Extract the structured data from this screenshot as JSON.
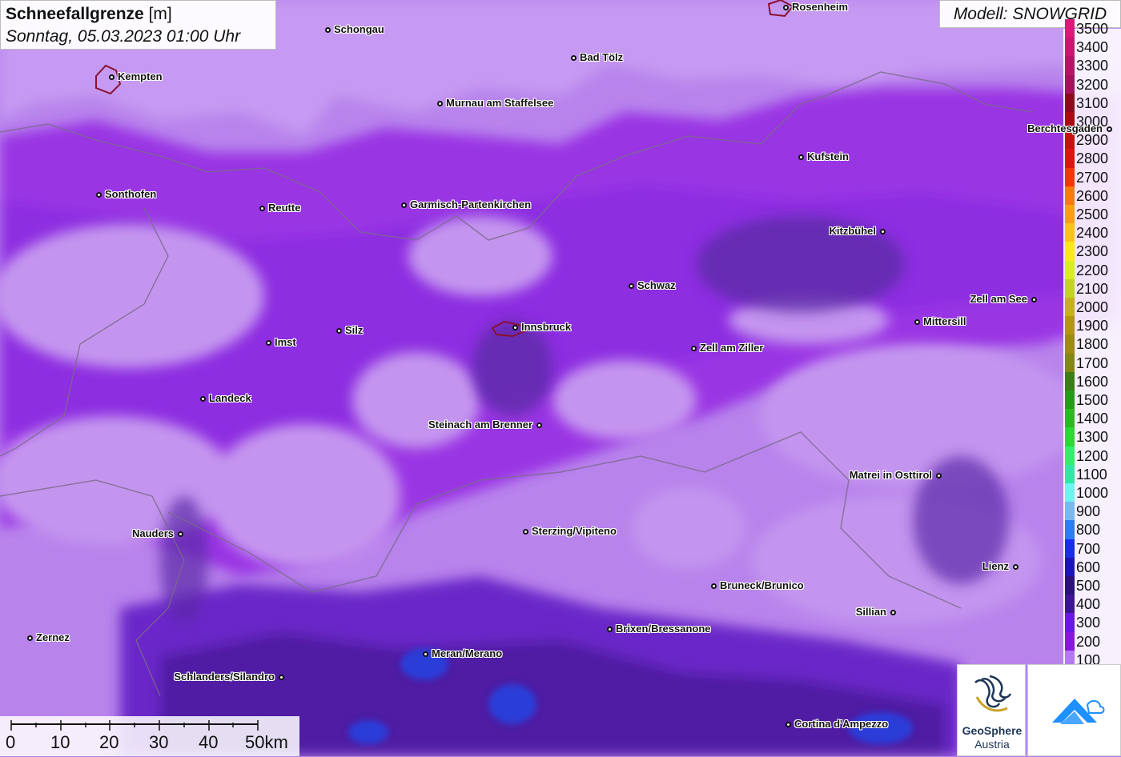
{
  "title": {
    "main": "Schneefallgrenze",
    "unit": "[m]",
    "datetime": "Sonntag, 05.03.2023 01:00 Uhr"
  },
  "model": "Modell: SNOWGRID",
  "legend": [
    {
      "label": "3500",
      "color": "#d81b78"
    },
    {
      "label": "3400",
      "color": "#c7186e"
    },
    {
      "label": "3300",
      "color": "#b51565"
    },
    {
      "label": "3200",
      "color": "#a3135b"
    },
    {
      "label": "3100",
      "color": "#8b0a1c"
    },
    {
      "label": "3000",
      "color": "#a80c12"
    },
    {
      "label": "2900",
      "color": "#c8100e"
    },
    {
      "label": "2800",
      "color": "#e0140d"
    },
    {
      "label": "2700",
      "color": "#f5350a"
    },
    {
      "label": "2600",
      "color": "#f57c10"
    },
    {
      "label": "2500",
      "color": "#f9a010"
    },
    {
      "label": "2400",
      "color": "#fbc412"
    },
    {
      "label": "2300",
      "color": "#fbe914"
    },
    {
      "label": "2200",
      "color": "#d8ef1a"
    },
    {
      "label": "2100",
      "color": "#c2d51c"
    },
    {
      "label": "2000",
      "color": "#c7b01b"
    },
    {
      "label": "1900",
      "color": "#b69416"
    },
    {
      "label": "1800",
      "color": "#9e8a14"
    },
    {
      "label": "1700",
      "color": "#83861a"
    },
    {
      "label": "1600",
      "color": "#3c7d18"
    },
    {
      "label": "1500",
      "color": "#2a9a1c"
    },
    {
      "label": "1400",
      "color": "#2cb826"
    },
    {
      "label": "1300",
      "color": "#2ed63a"
    },
    {
      "label": "1200",
      "color": "#2ef06c"
    },
    {
      "label": "1100",
      "color": "#2ee8a6"
    },
    {
      "label": "1000",
      "color": "#6ef3ee"
    },
    {
      "label": "900",
      "color": "#7ab8f0"
    },
    {
      "label": "800",
      "color": "#2e7cf0"
    },
    {
      "label": "700",
      "color": "#1b2de8"
    },
    {
      "label": "600",
      "color": "#1d14b8"
    },
    {
      "label": "500",
      "color": "#2c1178"
    },
    {
      "label": "400",
      "color": "#3e1590"
    },
    {
      "label": "300",
      "color": "#6a18e0"
    },
    {
      "label": "200",
      "color": "#8818d8"
    },
    {
      "label": "100",
      "color": "#b478f0"
    }
  ],
  "cities": [
    {
      "name": "Rosenheim"
    },
    {
      "name": "Schongau"
    },
    {
      "name": "Bad Tölz"
    },
    {
      "name": "Kempten"
    },
    {
      "name": "Murnau am Staffelsee"
    },
    {
      "name": "Berchtesgaden"
    },
    {
      "name": "Kufstein"
    },
    {
      "name": "Sonthofen"
    },
    {
      "name": "Reutte"
    },
    {
      "name": "Garmisch-Partenkirchen"
    },
    {
      "name": "Kitzbühel"
    },
    {
      "name": "Schwaz"
    },
    {
      "name": "Zell am See"
    },
    {
      "name": "Mittersill"
    },
    {
      "name": "Innsbruck"
    },
    {
      "name": "Silz"
    },
    {
      "name": "Imst"
    },
    {
      "name": "Zell am Ziller"
    },
    {
      "name": "Landeck"
    },
    {
      "name": "Steinach am Brenner"
    },
    {
      "name": "Matrei in Osttirol"
    },
    {
      "name": "Nauders"
    },
    {
      "name": "Sterzing/Vipiteno"
    },
    {
      "name": "Lienz"
    },
    {
      "name": "Bruneck/Brunico"
    },
    {
      "name": "Sillian"
    },
    {
      "name": "Brixen/Bressanone"
    },
    {
      "name": "Zernez"
    },
    {
      "name": "Meran/Merano"
    },
    {
      "name": "Schlanders/Silandro"
    },
    {
      "name": "Cortina d'Ampezzo"
    }
  ],
  "scale": {
    "labels": [
      "0",
      "10",
      "20",
      "30",
      "40",
      "50km"
    ]
  },
  "logos": {
    "geosphere_line1": "GeoSphere",
    "geosphere_line2": "Austria"
  }
}
